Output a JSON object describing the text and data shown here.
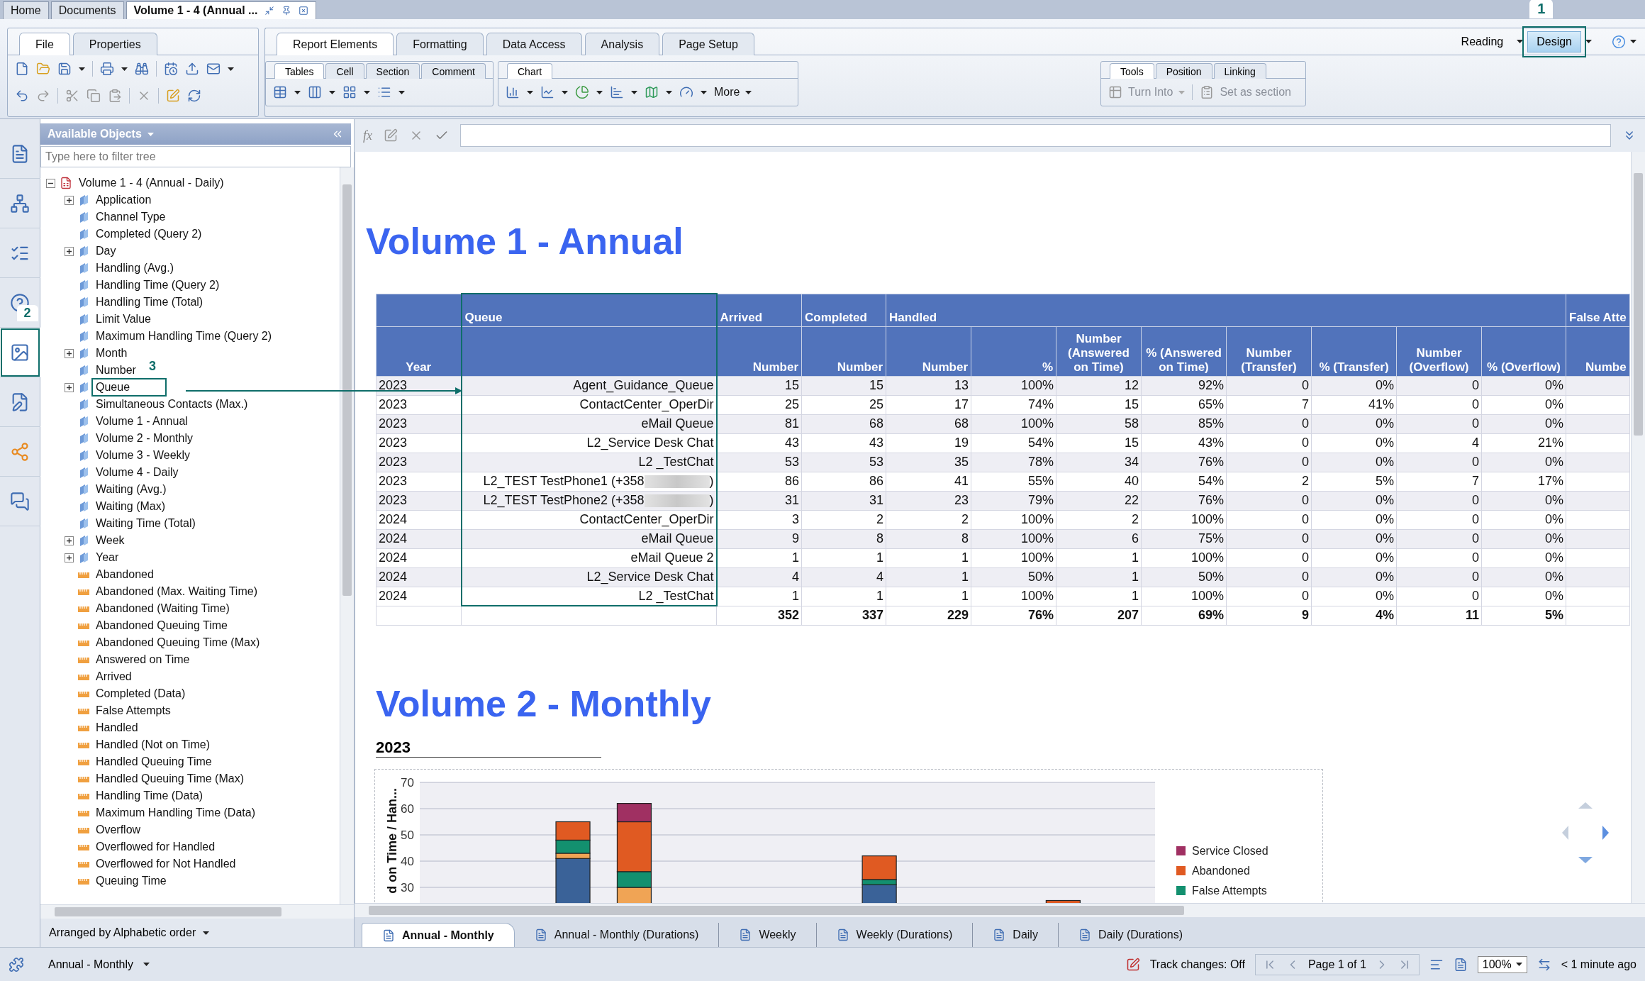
{
  "document_tabs": [
    {
      "label": "Home",
      "selected": false
    },
    {
      "label": "Documents",
      "selected": false
    },
    {
      "label": "Volume 1 - 4 (Annual ...",
      "selected": true
    }
  ],
  "ribbon": {
    "left_tabs": [
      {
        "label": "File",
        "selected": true
      },
      {
        "label": "Properties",
        "selected": false
      }
    ],
    "main_tabs": [
      {
        "label": "Report Elements",
        "selected": true
      },
      {
        "label": "Formatting",
        "selected": false
      },
      {
        "label": "Data Access",
        "selected": false
      },
      {
        "label": "Analysis",
        "selected": false
      },
      {
        "label": "Page Setup",
        "selected": false
      }
    ],
    "sub_groups": [
      {
        "tabs": [
          {
            "label": "Tables",
            "selected": true
          },
          {
            "label": "Cell",
            "selected": false
          },
          {
            "label": "Section",
            "selected": false
          },
          {
            "label": "Comment",
            "selected": false
          }
        ]
      },
      {
        "tabs": [
          {
            "label": "Chart",
            "selected": true
          }
        ]
      },
      {
        "tabs": [
          {
            "label": "Tools",
            "selected": true
          },
          {
            "label": "Position",
            "selected": false
          },
          {
            "label": "Linking",
            "selected": false
          }
        ]
      }
    ],
    "more": "More",
    "turn_into": {
      "label": "Turn Into",
      "disabled": true
    },
    "set_as_section": {
      "label": "Set as section",
      "disabled": true
    },
    "modes": [
      {
        "label": "Reading",
        "selected": false
      },
      {
        "label": "Design",
        "selected": true,
        "callout": "1"
      }
    ]
  },
  "side_icons": [
    {
      "selected": false
    },
    {
      "selected": false
    },
    {
      "selected": false
    },
    {
      "selected": false
    },
    {
      "selected": true,
      "callout": "2"
    },
    {
      "selected": false
    },
    {
      "selected": false
    },
    {
      "selected": false
    }
  ],
  "objects_panel": {
    "title": "Available Objects",
    "filter_placeholder": "Type here to filter tree",
    "footer": "Arranged by Alphabetic order",
    "tree": {
      "label": "Volume 1 - 4 (Annual - Daily)",
      "expanded": true,
      "children": [
        {
          "label": "Application",
          "kind": "dimension",
          "expanded": false
        },
        {
          "label": "Channel Type",
          "kind": "dimension"
        },
        {
          "label": "Completed (Query 2)",
          "kind": "dimension"
        },
        {
          "label": "Day",
          "kind": "dimension",
          "expanded": false
        },
        {
          "label": "Handling (Avg.)",
          "kind": "dimension"
        },
        {
          "label": "Handling Time (Query 2)",
          "kind": "dimension"
        },
        {
          "label": "Handling Time (Total)",
          "kind": "dimension"
        },
        {
          "label": "Limit Value",
          "kind": "dimension"
        },
        {
          "label": "Maximum Handling Time (Query 2)",
          "kind": "dimension"
        },
        {
          "label": "Month",
          "kind": "dimension",
          "expanded": false
        },
        {
          "label": "Number",
          "kind": "dimension"
        },
        {
          "label": "Queue",
          "kind": "dimension",
          "expanded": false,
          "callout": "3"
        },
        {
          "label": "Simultaneous Contacts (Max.)",
          "kind": "dimension"
        },
        {
          "label": "Volume 1 - Annual",
          "kind": "dimension"
        },
        {
          "label": "Volume 2 - Monthly",
          "kind": "dimension"
        },
        {
          "label": "Volume 3 - Weekly",
          "kind": "dimension"
        },
        {
          "label": "Volume 4 - Daily",
          "kind": "dimension"
        },
        {
          "label": "Waiting (Avg.)",
          "kind": "dimension"
        },
        {
          "label": "Waiting (Max)",
          "kind": "dimension"
        },
        {
          "label": "Waiting Time (Total)",
          "kind": "dimension"
        },
        {
          "label": "Week",
          "kind": "dimension",
          "expanded": false
        },
        {
          "label": "Year",
          "kind": "dimension",
          "expanded": false
        },
        {
          "label": "Abandoned",
          "kind": "measure"
        },
        {
          "label": "Abandoned (Max. Waiting Time)",
          "kind": "measure"
        },
        {
          "label": "Abandoned (Waiting Time)",
          "kind": "measure"
        },
        {
          "label": "Abandoned Queuing Time",
          "kind": "measure"
        },
        {
          "label": "Abandoned Queuing Time (Max)",
          "kind": "measure"
        },
        {
          "label": "Answered on Time",
          "kind": "measure"
        },
        {
          "label": "Arrived",
          "kind": "measure"
        },
        {
          "label": "Completed (Data)",
          "kind": "measure"
        },
        {
          "label": "False Attempts",
          "kind": "measure"
        },
        {
          "label": "Handled",
          "kind": "measure"
        },
        {
          "label": "Handled (Not on Time)",
          "kind": "measure"
        },
        {
          "label": "Handled Queuing Time",
          "kind": "measure"
        },
        {
          "label": "Handled Queuing Time (Max)",
          "kind": "measure"
        },
        {
          "label": "Handling Time (Data)",
          "kind": "measure"
        },
        {
          "label": "Maximum Handling Time (Data)",
          "kind": "measure"
        },
        {
          "label": "Overflow",
          "kind": "measure"
        },
        {
          "label": "Overflowed for Handled",
          "kind": "measure"
        },
        {
          "label": "Overflowed for Not Handled",
          "kind": "measure"
        },
        {
          "label": "Queuing Time",
          "kind": "measure"
        }
      ]
    }
  },
  "formula_bar": {
    "label": "fx"
  },
  "report": {
    "title": "Volume 1 - Annual",
    "table": {
      "column_groups": [
        {
          "columns": [
            {
              "label": "Year",
              "kind": "year"
            }
          ]
        },
        {
          "label": "Queue",
          "columns": [
            {
              "kind": "name",
              "highlighted": true
            }
          ]
        },
        {
          "label": "Arrived",
          "columns": [
            {
              "label": "Number",
              "kind": "number"
            }
          ]
        },
        {
          "label": "Completed",
          "columns": [
            {
              "label": "Number",
              "kind": "number"
            }
          ]
        },
        {
          "label": "Handled",
          "columns": [
            {
              "label": "Number",
              "kind": "number"
            },
            {
              "label": "%",
              "kind": "number"
            },
            {
              "label": "Number (Answered on Time)",
              "kind": "number"
            },
            {
              "label": "% (Answered on Time)",
              "kind": "number"
            },
            {
              "label": "Number (Transfer)",
              "kind": "number"
            },
            {
              "label": "% (Transfer)",
              "kind": "number"
            },
            {
              "label": "Number (Overflow)",
              "kind": "number"
            },
            {
              "label": "% (Overflow)",
              "kind": "number"
            }
          ]
        },
        {
          "label": "False Atte",
          "columns": [
            {
              "label": "Numbe",
              "kind": "number"
            }
          ]
        }
      ],
      "rows": [
        {
          "year": "2023",
          "queue": "Agent_Guidance_Queue",
          "redacted": false,
          "values": [
            "15",
            "15",
            "13",
            "100%",
            "12",
            "92%",
            "0",
            "0%",
            "0",
            "0%"
          ]
        },
        {
          "year": "2023",
          "queue": "ContactCenter_OperDir",
          "redacted": false,
          "values": [
            "25",
            "25",
            "17",
            "74%",
            "15",
            "65%",
            "7",
            "41%",
            "0",
            "0%"
          ]
        },
        {
          "year": "2023",
          "queue": "eMail Queue",
          "redacted": false,
          "values": [
            "81",
            "68",
            "68",
            "100%",
            "58",
            "85%",
            "0",
            "0%",
            "0",
            "0%"
          ]
        },
        {
          "year": "2023",
          "queue": "L2_Service Desk Chat",
          "redacted": false,
          "values": [
            "43",
            "43",
            "19",
            "54%",
            "15",
            "43%",
            "0",
            "0%",
            "4",
            "21%"
          ]
        },
        {
          "year": "2023",
          "queue": "L2 _TestChat",
          "redacted": false,
          "values": [
            "53",
            "53",
            "35",
            "78%",
            "34",
            "76%",
            "0",
            "0%",
            "0",
            "0%"
          ]
        },
        {
          "year": "2023",
          "queue": "L2_TEST TestPhone1 (+358",
          "redacted": true,
          "queue_tail": ")",
          "values": [
            "86",
            "86",
            "41",
            "55%",
            "40",
            "54%",
            "2",
            "5%",
            "7",
            "17%"
          ]
        },
        {
          "year": "2023",
          "queue": "L2_TEST TestPhone2 (+358",
          "redacted": true,
          "queue_tail": ")",
          "values": [
            "31",
            "31",
            "23",
            "79%",
            "22",
            "76%",
            "0",
            "0%",
            "0",
            "0%"
          ]
        },
        {
          "year": "2024",
          "queue": "ContactCenter_OperDir",
          "redacted": false,
          "values": [
            "3",
            "2",
            "2",
            "100%",
            "2",
            "100%",
            "0",
            "0%",
            "0",
            "0%"
          ]
        },
        {
          "year": "2024",
          "queue": "eMail Queue",
          "redacted": false,
          "values": [
            "9",
            "8",
            "8",
            "100%",
            "6",
            "75%",
            "0",
            "0%",
            "0",
            "0%"
          ]
        },
        {
          "year": "2024",
          "queue": "eMail Queue 2",
          "redacted": false,
          "values": [
            "1",
            "1",
            "1",
            "100%",
            "1",
            "100%",
            "0",
            "0%",
            "0",
            "0%"
          ]
        },
        {
          "year": "2024",
          "queue": "L2_Service Desk Chat",
          "redacted": false,
          "values": [
            "4",
            "4",
            "1",
            "50%",
            "1",
            "50%",
            "0",
            "0%",
            "0",
            "0%"
          ]
        },
        {
          "year": "2024",
          "queue": "L2 _TestChat",
          "redacted": false,
          "values": [
            "1",
            "1",
            "1",
            "100%",
            "1",
            "100%",
            "0",
            "0%",
            "0",
            "0%"
          ]
        }
      ],
      "total": [
        "352",
        "337",
        "229",
        "76%",
        "207",
        "69%",
        "9",
        "4%",
        "11",
        "5%"
      ]
    },
    "section_title": "Volume 2 - Monthly",
    "section_subtitle": "2023",
    "chart_data": {
      "type": "bar",
      "stacked": true,
      "grid": true,
      "legend": "right",
      "ylabel": "d on Time / Han...",
      "ylim": [
        0,
        70
      ],
      "yticks": [
        30,
        40,
        50,
        60,
        70
      ],
      "series": [
        {
          "color": "#3a6298",
          "values": [
            null,
            null,
            41,
            0,
            null,
            null,
            null,
            31,
            null,
            null,
            0,
            null
          ]
        },
        {
          "color": "#f0a455",
          "values": [
            null,
            null,
            2,
            30,
            null,
            null,
            null,
            0,
            null,
            null,
            0,
            null
          ]
        },
        {
          "name": "False Attempts",
          "color": "#13906f",
          "values": [
            null,
            null,
            5,
            6,
            null,
            null,
            null,
            2,
            null,
            null,
            0,
            null
          ]
        },
        {
          "name": "Abandoned",
          "color": "#e05a22",
          "values": [
            null,
            null,
            7,
            19,
            null,
            null,
            null,
            9,
            null,
            null,
            25,
            null
          ]
        },
        {
          "name": "Service Closed",
          "color": "#a03062",
          "values": [
            null,
            null,
            0,
            7,
            null,
            null,
            null,
            0,
            null,
            null,
            0,
            null
          ]
        }
      ]
    }
  },
  "report_tabs": [
    {
      "label": "Annual - Monthly",
      "selected": true
    },
    {
      "label": "Annual - Monthly (Durations)",
      "selected": false
    },
    {
      "label": "Weekly",
      "selected": false
    },
    {
      "label": "Weekly (Durations)",
      "selected": false
    },
    {
      "label": "Daily",
      "selected": false
    },
    {
      "label": "Daily (Durations)",
      "selected": false
    }
  ],
  "status_bar": {
    "report": "Annual - Monthly",
    "track_changes": "Track changes: Off",
    "page": "Page 1 of 1",
    "zoom": "100%",
    "refreshed": "< 1 minute ago"
  }
}
